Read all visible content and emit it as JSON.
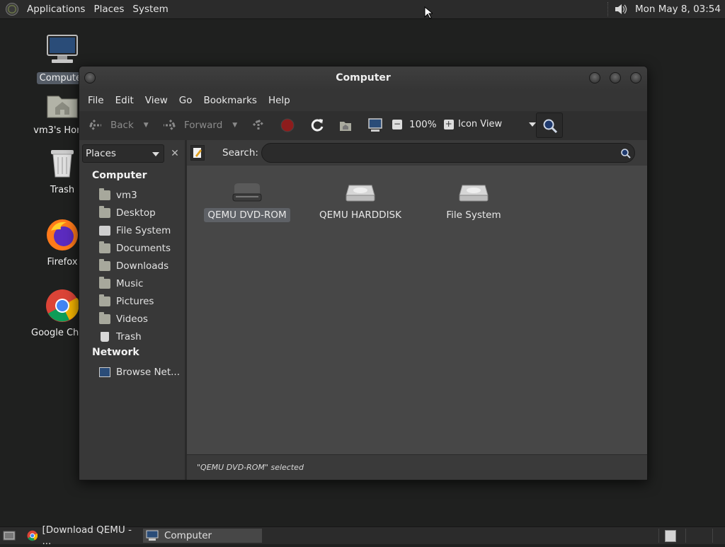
{
  "top_panel": {
    "menus": [
      "Applications",
      "Places",
      "System"
    ],
    "clock": "Mon May  8, 03:54"
  },
  "desktop_icons": [
    {
      "label": "Computer",
      "icon": "computer-icon",
      "selected": true
    },
    {
      "label": "vm3's Home",
      "icon": "home-folder-icon"
    },
    {
      "label": "Trash",
      "icon": "trash-icon"
    },
    {
      "label": "Firefox",
      "icon": "firefox-icon"
    },
    {
      "label": "Google Chrome",
      "icon": "chrome-icon"
    }
  ],
  "window": {
    "title": "Computer",
    "menubar": [
      "File",
      "Edit",
      "View",
      "Go",
      "Bookmarks",
      "Help"
    ],
    "toolbar": {
      "back": "Back",
      "forward": "Forward",
      "zoom": "100%",
      "view_mode": "Icon View"
    },
    "sidebar": {
      "selector": "Places",
      "sections": [
        {
          "heading": "Computer",
          "items": [
            "vm3",
            "Desktop",
            "File System",
            "Documents",
            "Downloads",
            "Music",
            "Pictures",
            "Videos",
            "Trash"
          ]
        },
        {
          "heading": "Network",
          "items": [
            "Browse Net..."
          ]
        }
      ]
    },
    "search": {
      "label": "Search:",
      "value": ""
    },
    "items": [
      {
        "label": "QEMU DVD-ROM",
        "icon": "optical-drive-icon",
        "selected": true
      },
      {
        "label": "QEMU HARDDISK",
        "icon": "harddisk-icon",
        "selected": false
      },
      {
        "label": "File System",
        "icon": "harddisk-icon",
        "selected": false
      }
    ],
    "status": "\"QEMU DVD-ROM\" selected"
  },
  "taskbar": {
    "tasks": [
      {
        "label": "[Download QEMU - ...",
        "icon": "chrome-icon",
        "active": false
      },
      {
        "label": "Computer",
        "icon": "computer-icon",
        "active": true
      }
    ]
  }
}
